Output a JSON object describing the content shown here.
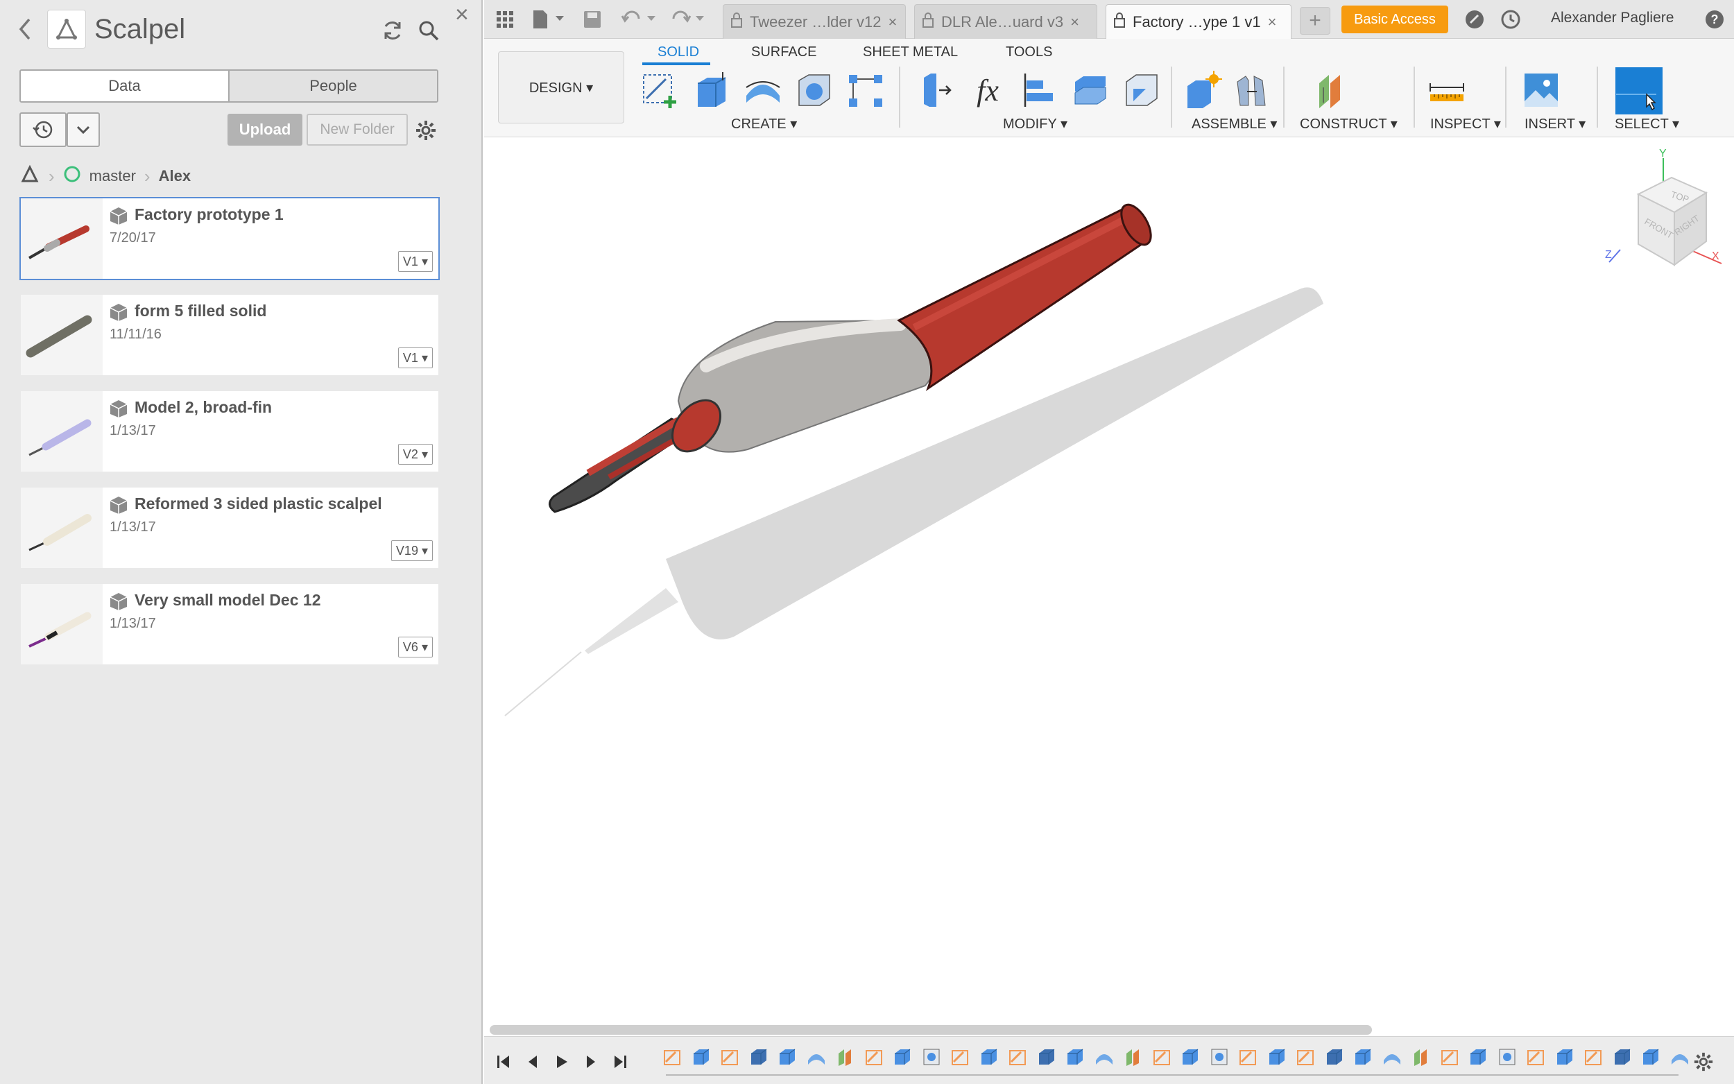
{
  "panel": {
    "title": "Scalpel",
    "tabs": {
      "data": "Data",
      "people": "People"
    },
    "upload": "Upload",
    "new_folder": "New Folder",
    "breadcrumb": {
      "branch": "master",
      "folder": "Alex"
    },
    "items": [
      {
        "name": "Factory prototype 1",
        "date": "7/20/17",
        "version": "V1"
      },
      {
        "name": "form 5 filled solid",
        "date": "11/11/16",
        "version": "V1"
      },
      {
        "name": "Model 2, broad-fin",
        "date": "1/13/17",
        "version": "V2"
      },
      {
        "name": "Reformed 3 sided plastic scalpel",
        "date": "1/13/17",
        "version": "V19"
      },
      {
        "name": "Very small model Dec 12",
        "date": "1/13/17",
        "version": "V6"
      }
    ]
  },
  "tabbar": {
    "tabs": [
      {
        "label": "Tweezer …lder v12"
      },
      {
        "label": "DLR Ale…uard v3"
      },
      {
        "label": "Factory …ype 1 v1"
      }
    ],
    "basic_access": "Basic Access",
    "user": "Alexander Pagliere"
  },
  "ribbon": {
    "workspace": "DESIGN",
    "tabs": [
      "SOLID",
      "SURFACE",
      "SHEET METAL",
      "TOOLS"
    ],
    "groups": {
      "create": "CREATE",
      "modify": "MODIFY",
      "assemble": "ASSEMBLE",
      "construct": "CONSTRUCT",
      "inspect": "INSPECT",
      "insert": "INSERT",
      "select": "SELECT"
    },
    "fx": "fx"
  },
  "viewcube": {
    "top": "TOP",
    "front": "FRONT",
    "right": "RIGHT",
    "x": "X",
    "y": "Y",
    "z": "Z"
  },
  "colors": {
    "accent": "#1a7fd4",
    "basic_access": "#f79b10",
    "handle_red": "#b7392e",
    "selection": "#5b8ed6"
  }
}
